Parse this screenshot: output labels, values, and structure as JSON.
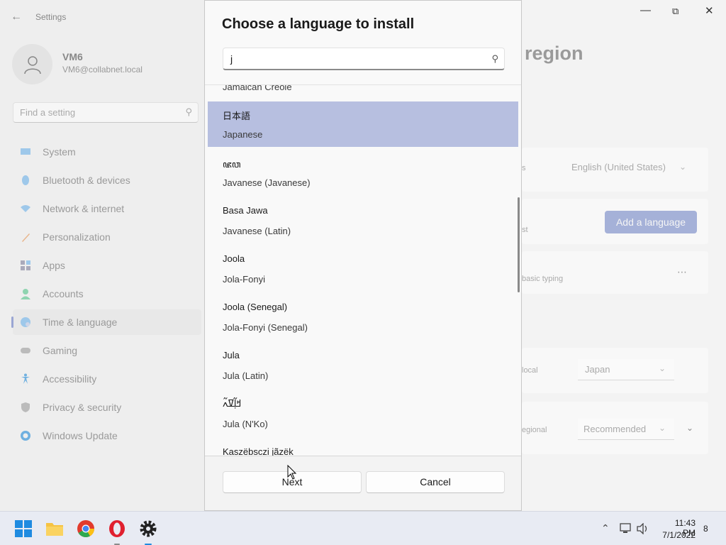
{
  "settings": {
    "window_title": "Settings",
    "user": {
      "name": "VM6",
      "email": "VM6@collabnet.local"
    },
    "search_placeholder": "Find a setting",
    "nav": [
      {
        "label": "System",
        "icon": "system-icon"
      },
      {
        "label": "Bluetooth & devices",
        "icon": "bluetooth-icon"
      },
      {
        "label": "Network & internet",
        "icon": "wifi-icon"
      },
      {
        "label": "Personalization",
        "icon": "brush-icon"
      },
      {
        "label": "Apps",
        "icon": "apps-icon"
      },
      {
        "label": "Accounts",
        "icon": "accounts-icon"
      },
      {
        "label": "Time & language",
        "icon": "globe-clock-icon",
        "active": true
      },
      {
        "label": "Gaming",
        "icon": "gamepad-icon"
      },
      {
        "label": "Accessibility",
        "icon": "accessibility-icon"
      },
      {
        "label": "Privacy & security",
        "icon": "shield-icon"
      },
      {
        "label": "Windows Update",
        "icon": "update-icon"
      }
    ],
    "main": {
      "page_title_fragment": "region",
      "display_lang_fragment": "s",
      "display_lang_value": "English (United States)",
      "preferred_fragment": "st",
      "add_language_label": "Add a language",
      "typing_fragment": "basic typing",
      "country_fragment": "local",
      "country_value": "Japan",
      "regional_fragment": "egional",
      "regional_value": "Recommended"
    }
  },
  "dialog": {
    "title": "Choose a language to install",
    "search_value": "j",
    "partial_top": "Jamaican Creole",
    "languages": [
      {
        "native": "日本語",
        "english": "Japanese",
        "selected": true
      },
      {
        "native": "ꦗꦮ",
        "english": "Javanese (Javanese)"
      },
      {
        "native": "Basa Jawa",
        "english": "Javanese (Latin)"
      },
      {
        "native": "Joola",
        "english": "Jola-Fonyi"
      },
      {
        "native": "Joola (Senegal)",
        "english": "Jola-Fonyi (Senegal)"
      },
      {
        "native": "Jula",
        "english": "Jula (Latin)"
      },
      {
        "native": "ߞߊ߲߬ߜߍ߬",
        "english": "Jula (N'Ko)"
      },
      {
        "native": "Kaszëbsczi jãzëk",
        "english": ""
      }
    ],
    "next_label": "Next",
    "cancel_label": "Cancel"
  },
  "taskbar": {
    "time": "11:43 PM",
    "date": "7/1/2022",
    "notification_count": "8"
  }
}
